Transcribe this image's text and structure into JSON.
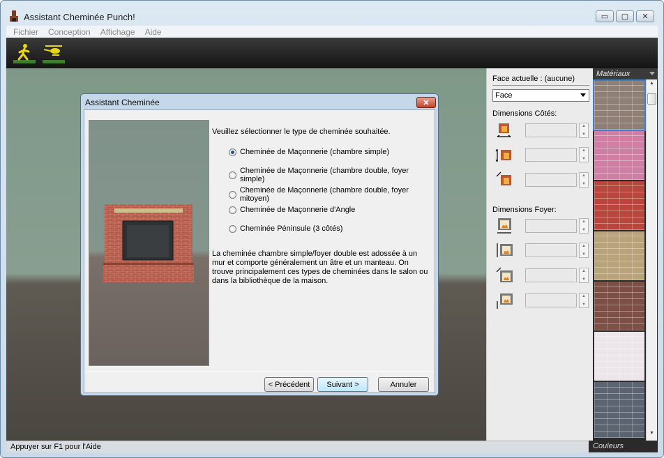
{
  "window": {
    "title": "Assistant Cheminée Punch!",
    "controls": {
      "minimize": "▭",
      "maximize": "▢",
      "close": "✕"
    }
  },
  "menu": [
    "Fichier",
    "Conception",
    "Affichage",
    "Aide"
  ],
  "toolbar": {
    "icons": [
      "walk-mode-icon",
      "helicopter-view-icon"
    ]
  },
  "dialog": {
    "title": "Assistant Cheminée",
    "close": "✕",
    "prompt": "Veuillez sélectionner le type de cheminée souhaitée.",
    "options": [
      {
        "label": "Cheminée de Maçonnerie (chambre simple)",
        "selected": true
      },
      {
        "label": "Cheminée de Maçonnerie (chambre double, foyer simple)",
        "selected": false
      },
      {
        "label": "Cheminée de Maçonnerie (chambre double, foyer mitoyen)",
        "selected": false
      },
      {
        "label": "Cheminée de Maçonnerie d'Angle",
        "selected": false
      },
      {
        "label": "Cheminée Péninsule (3 côtés)",
        "selected": false
      }
    ],
    "description": "La cheminée chambre simple/foyer double est adossée à un mur et comporte généralement un âtre et un manteau.  On trouve principalement ces types de cheminées dans le salon ou dans la bibliothèque de la maison.",
    "buttons": {
      "previous": "< Précédent",
      "next": "Suivant >",
      "cancel": "Annuler"
    }
  },
  "properties": {
    "current_face": "Face actuelle : (aucune)",
    "face_select": "Face",
    "sides_label": "Dimensions Côtés:",
    "hearth_label": "Dimensions Foyer:"
  },
  "materials": {
    "header": "Matériaux",
    "swatch_colors": [
      "#8f7f74",
      "#cf7fa4",
      "#b8463c",
      "#b9a37a",
      "#7e4f44",
      "#ece6ea",
      "#5b6470"
    ],
    "footer": "Couleurs"
  },
  "status": "Appuyer sur F1 pour l'Aide"
}
